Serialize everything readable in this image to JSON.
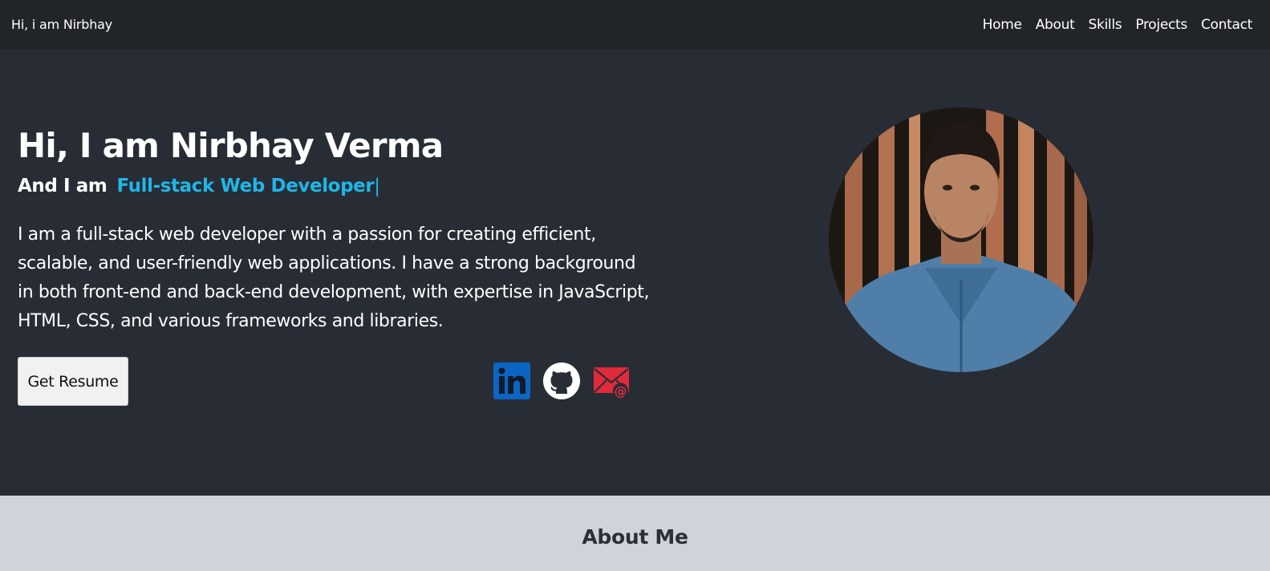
{
  "navbar": {
    "brand": "Hi, i am Nirbhay",
    "links": [
      "Home",
      "About",
      "Skills",
      "Projects",
      "Contact"
    ]
  },
  "hero": {
    "title": "Hi, I am Nirbhay Verma",
    "subtitle_prefix": "And I am",
    "role": "Full-stack Web Developer",
    "cursor": "|",
    "description": "I am a full-stack web developer with a passion for creating efficient, scalable, and user-friendly web applications. I have a strong background in both front-end and back-end development, with expertise in JavaScript, HTML, CSS, and various frameworks and libraries.",
    "resume_button": "Get Resume",
    "socials": [
      {
        "icon": "linkedin-icon",
        "color": "#0a66c2"
      },
      {
        "icon": "github-icon",
        "color": "#ffffff"
      },
      {
        "icon": "email-icon",
        "color": "#e02b3c"
      }
    ]
  },
  "about": {
    "title": "About Me"
  },
  "colors": {
    "navbar_bg": "#212529",
    "hero_bg": "#282c34",
    "accent": "#1fb6e8",
    "about_bg": "#cfd3dc"
  }
}
